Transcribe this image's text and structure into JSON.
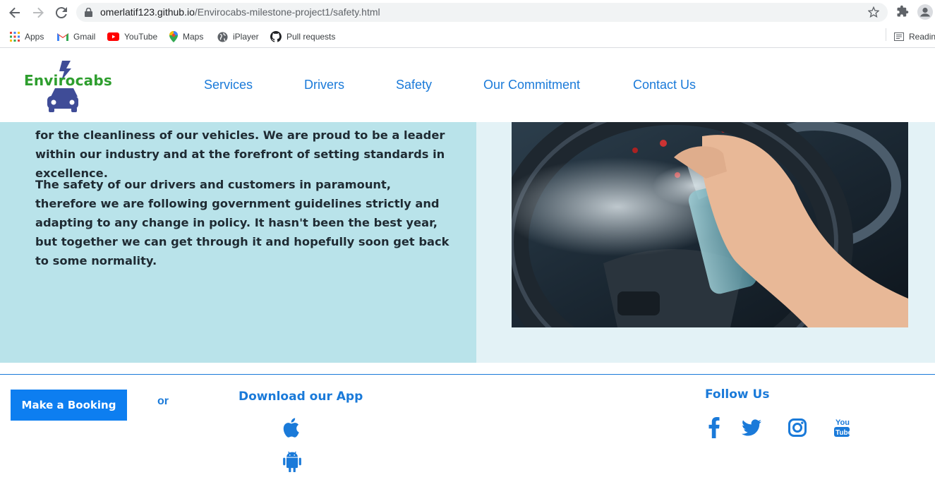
{
  "browser": {
    "url_host": "omerlatif123.github.io",
    "url_path": "/Envirocabs-milestone-project1/safety.html",
    "bookmarks": [
      {
        "label": "Apps",
        "icon": "apps-grid-icon"
      },
      {
        "label": "Gmail",
        "icon": "gmail-icon"
      },
      {
        "label": "YouTube",
        "icon": "youtube-icon"
      },
      {
        "label": "Maps",
        "icon": "maps-pin-icon"
      },
      {
        "label": "iPlayer",
        "icon": "globe-icon"
      },
      {
        "label": "Pull requests",
        "icon": "github-icon"
      }
    ],
    "reading_list": "Readin"
  },
  "header": {
    "logo_text": "Envirocabs",
    "nav": [
      "Services",
      "Drivers",
      "Safety",
      "Our Commitment",
      "Contact Us"
    ]
  },
  "main": {
    "paragraphs": [
      "for the cleanliness of our vehicles. We are proud to be a leader within our industry and at the forefront of setting standards in excellence.",
      "The safety of our drivers and customers in paramount, therefore we are following government guidelines strictly and adapting to any change in policy. It hasn't been the best year, but together we can get through it and hopefully soon get back to some normality."
    ]
  },
  "footer": {
    "booking_label": "Make a Booking",
    "or_text": "or",
    "download_title": "Download our App",
    "follow_title": "Follow Us",
    "app_icons": [
      "apple-icon",
      "android-icon"
    ],
    "social_icons": [
      "facebook-icon",
      "twitter-icon",
      "instagram-icon",
      "youtube-icon"
    ]
  },
  "colors": {
    "link_blue": "#1a7ad9",
    "button_blue": "#0d7ef0",
    "text_panel": "#b9e3ea",
    "image_panel": "#e3f2f6",
    "logo_green": "#2e9e2e"
  }
}
